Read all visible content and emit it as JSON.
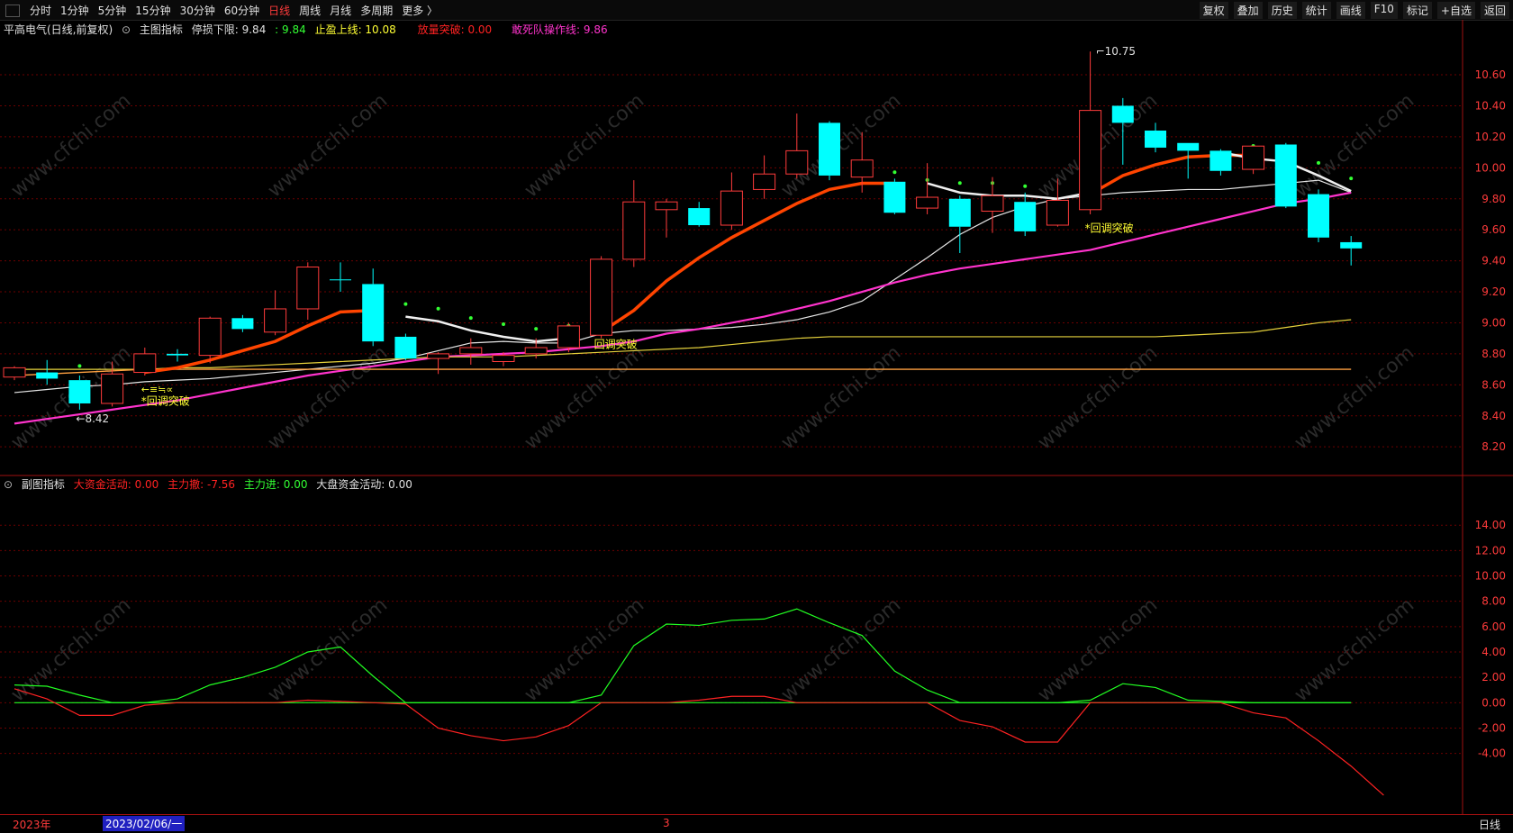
{
  "toolbar": {
    "periods": [
      "分时",
      "1分钟",
      "5分钟",
      "15分钟",
      "30分钟",
      "60分钟",
      "日线",
      "周线",
      "月线",
      "多周期",
      "更多 〉"
    ],
    "active_period": "日线",
    "right_buttons": [
      "复权",
      "叠加",
      "历史",
      "统计",
      "画线",
      "F10",
      "标记",
      "+自选",
      "返回"
    ]
  },
  "main_info": {
    "stock": "平高电气(日线,前复权)",
    "indicator": "主图指标",
    "stoploss_label": "停损下限: 9.84",
    "value2": ": 9.84",
    "takeprofit_label": "止盈上线: 10.08",
    "breakout_label": "放量突破: 0.00",
    "opline_label": "敢死队操作线: 9.86"
  },
  "sub_info": {
    "indicator": "副图指标",
    "big_active": "大资金活动: 0.00",
    "main_out": "主力撤: -7.56",
    "main_in": "主力进: 0.00",
    "market_active": "大盘资金活动: 0.00"
  },
  "annotations": {
    "high_label": "10.75",
    "low_label": "8.42",
    "signal1": "*回调突破",
    "signal2": "回调突破",
    "signal3": "*回调突破",
    "arrow_label": "←≡≒∝"
  },
  "watermark": "www.cfchi.com",
  "bottom": {
    "year": "2023年",
    "date_cursor": "2023/02/06/一",
    "month_mark": "3",
    "period_label": "日线"
  },
  "chart_data": [
    {
      "type": "candlestick",
      "title": "",
      "y_ticks": [
        8.2,
        8.4,
        8.6,
        8.8,
        9.0,
        9.2,
        9.4,
        9.6,
        9.8,
        10.0,
        10.2,
        10.4,
        10.6
      ],
      "ylim": [
        8.05,
        10.85
      ],
      "candles": [
        {
          "o": 8.65,
          "h": 8.72,
          "l": 8.63,
          "c": 8.71,
          "color": "red"
        },
        {
          "o": 8.68,
          "h": 8.76,
          "l": 8.6,
          "c": 8.64,
          "color": "cyan"
        },
        {
          "o": 8.63,
          "h": 8.66,
          "l": 8.44,
          "c": 8.48,
          "color": "cyan"
        },
        {
          "o": 8.48,
          "h": 8.75,
          "l": 8.46,
          "c": 8.67,
          "color": "red"
        },
        {
          "o": 8.68,
          "h": 8.84,
          "l": 8.66,
          "c": 8.8,
          "color": "red"
        },
        {
          "o": 8.79,
          "h": 8.83,
          "l": 8.75,
          "c": 8.8,
          "color": "cyan"
        },
        {
          "o": 8.79,
          "h": 9.04,
          "l": 8.74,
          "c": 9.03,
          "color": "red"
        },
        {
          "o": 9.03,
          "h": 9.05,
          "l": 8.94,
          "c": 8.96,
          "color": "cyan"
        },
        {
          "o": 8.94,
          "h": 9.21,
          "l": 8.92,
          "c": 9.09,
          "color": "red"
        },
        {
          "o": 9.09,
          "h": 9.39,
          "l": 9.02,
          "c": 9.36,
          "color": "red"
        },
        {
          "o": 9.28,
          "h": 9.39,
          "l": 9.2,
          "c": 9.28,
          "color": "cyan"
        },
        {
          "o": 9.25,
          "h": 9.35,
          "l": 8.85,
          "c": 8.88,
          "color": "cyan"
        },
        {
          "o": 8.91,
          "h": 8.93,
          "l": 8.76,
          "c": 8.77,
          "color": "cyan"
        },
        {
          "o": 8.77,
          "h": 8.81,
          "l": 8.67,
          "c": 8.8,
          "color": "red"
        },
        {
          "o": 8.8,
          "h": 8.9,
          "l": 8.73,
          "c": 8.84,
          "color": "red"
        },
        {
          "o": 8.75,
          "h": 8.81,
          "l": 8.72,
          "c": 8.79,
          "color": "red"
        },
        {
          "o": 8.8,
          "h": 8.9,
          "l": 8.77,
          "c": 8.84,
          "color": "red"
        },
        {
          "o": 8.84,
          "h": 9.0,
          "l": 8.81,
          "c": 8.98,
          "color": "red"
        },
        {
          "o": 8.92,
          "h": 9.43,
          "l": 8.9,
          "c": 9.41,
          "color": "red"
        },
        {
          "o": 9.41,
          "h": 9.92,
          "l": 9.36,
          "c": 9.78,
          "color": "red"
        },
        {
          "o": 9.73,
          "h": 9.8,
          "l": 9.55,
          "c": 9.78,
          "color": "red"
        },
        {
          "o": 9.74,
          "h": 9.78,
          "l": 9.62,
          "c": 9.63,
          "color": "cyan"
        },
        {
          "o": 9.63,
          "h": 9.97,
          "l": 9.6,
          "c": 9.85,
          "color": "red"
        },
        {
          "o": 9.86,
          "h": 10.08,
          "l": 9.8,
          "c": 9.96,
          "color": "red"
        },
        {
          "o": 9.96,
          "h": 10.35,
          "l": 9.93,
          "c": 10.11,
          "color": "red"
        },
        {
          "o": 10.29,
          "h": 10.3,
          "l": 9.92,
          "c": 9.95,
          "color": "cyan"
        },
        {
          "o": 9.94,
          "h": 10.23,
          "l": 9.84,
          "c": 10.05,
          "color": "red"
        },
        {
          "o": 9.91,
          "h": 9.93,
          "l": 9.7,
          "c": 9.71,
          "color": "cyan"
        },
        {
          "o": 9.74,
          "h": 10.03,
          "l": 9.7,
          "c": 9.81,
          "color": "red"
        },
        {
          "o": 9.8,
          "h": 9.82,
          "l": 9.45,
          "c": 9.62,
          "color": "cyan"
        },
        {
          "o": 9.72,
          "h": 9.94,
          "l": 9.58,
          "c": 9.82,
          "color": "red"
        },
        {
          "o": 9.78,
          "h": 9.84,
          "l": 9.56,
          "c": 9.59,
          "color": "cyan"
        },
        {
          "o": 9.63,
          "h": 9.93,
          "l": 9.62,
          "c": 9.79,
          "color": "red"
        },
        {
          "o": 9.73,
          "h": 10.75,
          "l": 9.7,
          "c": 10.37,
          "color": "red"
        },
        {
          "o": 10.4,
          "h": 10.45,
          "l": 10.02,
          "c": 10.29,
          "color": "cyan"
        },
        {
          "o": 10.24,
          "h": 10.29,
          "l": 10.1,
          "c": 10.13,
          "color": "cyan"
        },
        {
          "o": 10.16,
          "h": 10.16,
          "l": 9.93,
          "c": 10.11,
          "color": "cyan"
        },
        {
          "o": 10.11,
          "h": 10.12,
          "l": 9.95,
          "c": 9.98,
          "color": "cyan"
        },
        {
          "o": 9.99,
          "h": 10.14,
          "l": 9.96,
          "c": 10.14,
          "color": "red"
        },
        {
          "o": 10.15,
          "h": 10.16,
          "l": 9.74,
          "c": 9.75,
          "color": "cyan"
        },
        {
          "o": 9.83,
          "h": 9.86,
          "l": 9.52,
          "c": 9.55,
          "color": "cyan"
        },
        {
          "o": 9.52,
          "h": 9.56,
          "l": 9.37,
          "c": 9.48,
          "color": "cyan"
        }
      ],
      "series": [
        {
          "values": [
            8.55,
            8.57,
            8.59,
            8.6,
            8.62,
            8.63,
            8.64,
            8.66,
            8.68,
            8.7,
            8.72,
            8.74,
            8.77,
            8.82,
            8.87,
            8.88,
            8.87,
            8.87,
            8.93,
            8.95,
            8.95,
            8.96,
            8.97,
            8.99,
            9.02,
            9.07,
            9.14,
            9.28,
            9.42,
            9.57,
            9.68,
            9.75,
            9.8,
            9.82,
            9.84,
            9.85,
            9.86,
            9.86,
            9.88,
            9.9,
            9.92,
            9.84
          ]
        },
        {
          "values": [
            8.35,
            8.38,
            8.41,
            8.44,
            8.47,
            8.5,
            8.54,
            8.58,
            8.62,
            8.66,
            8.69,
            8.72,
            8.75,
            8.78,
            8.79,
            8.8,
            8.81,
            8.83,
            8.85,
            8.88,
            8.93,
            8.96,
            9.0,
            9.04,
            9.09,
            9.14,
            9.2,
            9.26,
            9.31,
            9.35,
            9.38,
            9.41,
            9.44,
            9.47,
            9.52,
            9.57,
            9.62,
            9.67,
            9.72,
            9.77,
            9.8,
            9.84
          ]
        },
        {
          "values": [
            8.7,
            8.7,
            8.7,
            8.7,
            8.7,
            8.71,
            8.71,
            8.72,
            8.73,
            8.74,
            8.75,
            8.76,
            8.77,
            8.78,
            8.78,
            8.78,
            8.79,
            8.8,
            8.81,
            8.82,
            8.83,
            8.84,
            8.86,
            8.88,
            8.9,
            8.91,
            8.91,
            8.91,
            8.91,
            8.91,
            8.91,
            8.91,
            8.91,
            8.91,
            8.91,
            8.91,
            8.92,
            8.93,
            8.94,
            8.97,
            9.0,
            9.02
          ]
        },
        {
          "values": [
            8.66,
            8.67,
            8.68,
            8.69,
            8.7,
            8.7,
            8.7,
            8.7,
            8.7,
            8.7,
            8.7,
            8.7,
            8.7,
            8.7,
            8.7,
            8.7,
            8.7,
            8.7,
            8.7,
            8.7,
            8.7,
            8.7,
            8.7,
            8.7,
            8.7,
            8.7,
            8.7,
            8.7,
            8.7,
            8.7,
            8.7,
            8.7,
            8.7,
            8.7,
            8.7,
            8.7,
            8.7,
            8.7,
            8.7,
            8.7,
            8.7,
            8.7
          ]
        },
        {
          "values": [
            null,
            null,
            null,
            null,
            8.68,
            8.71,
            8.76,
            8.82,
            8.88,
            8.98,
            9.07,
            9.08,
            null,
            null,
            null,
            null,
            null,
            null,
            8.94,
            9.08,
            9.27,
            9.42,
            9.55,
            9.66,
            9.77,
            9.86,
            9.9,
            9.9,
            null,
            null,
            null,
            null,
            null,
            9.83,
            9.95,
            10.02,
            10.07,
            10.08,
            10.08,
            null,
            null,
            null
          ]
        },
        {
          "values": [
            null,
            null,
            null,
            null,
            null,
            null,
            null,
            null,
            null,
            null,
            null,
            null,
            9.04,
            9.01,
            8.95,
            8.91,
            8.88,
            8.9,
            null,
            null,
            null,
            null,
            null,
            null,
            null,
            null,
            null,
            null,
            9.9,
            9.84,
            9.82,
            9.82,
            9.8,
            9.84,
            null,
            null,
            null,
            10.1,
            10.06,
            10.04,
            9.95,
            9.85
          ]
        },
        {
          "values": [
            null,
            null,
            8.64,
            null,
            8.68,
            null,
            null,
            null,
            null,
            null,
            null,
            null,
            9.04,
            9.01,
            8.95,
            8.91,
            8.88,
            8.9,
            null,
            null,
            null,
            null,
            null,
            null,
            null,
            null,
            null,
            9.89,
            9.84,
            9.82,
            9.82,
            9.8,
            null,
            null,
            null,
            null,
            null,
            null,
            10.06,
            10.04,
            9.95,
            9.85
          ]
        }
      ]
    },
    {
      "type": "line",
      "title": "",
      "y_ticks": [
        -4.0,
        -2.0,
        0.0,
        2.0,
        4.0,
        6.0,
        8.0,
        10.0,
        12.0,
        14.0
      ],
      "ylim": [
        -8.5,
        16.5
      ],
      "series": [
        {
          "values": [
            1.4,
            1.3,
            0.6,
            0.0,
            0.0,
            0.3,
            1.4,
            2.0,
            2.8,
            4.0,
            4.4,
            2.1,
            0.0,
            0.0,
            0.0,
            0.0,
            0.0,
            0.0,
            0.6,
            4.5,
            6.2,
            6.1,
            6.5,
            6.6,
            7.4,
            6.3,
            5.3,
            2.5,
            1.0,
            0.0,
            0.0,
            0.0,
            0.0,
            0.2,
            1.5,
            1.2,
            0.2,
            0.1,
            0.0,
            0.0,
            0.0,
            0.0
          ]
        },
        {
          "values": [
            1.1,
            0.3,
            -1.0,
            -1.0,
            -0.2,
            0.0,
            0.0,
            0.0,
            0.0,
            0.2,
            0.1,
            0.0,
            -0.1,
            -2.0,
            -2.6,
            -3.0,
            -2.7,
            -1.8,
            0.0,
            0.0,
            0.0,
            0.2,
            0.5,
            0.5,
            0.0,
            0.0,
            0.0,
            0.0,
            0.0,
            -1.4,
            -1.9,
            -3.1,
            -3.1,
            0.0,
            0.0,
            0.0,
            0.0,
            0.0,
            -0.8,
            -1.2,
            -3.0,
            -5.0,
            -7.3
          ]
        },
        {
          "values": [
            0.0,
            0.0,
            0.0,
            0.0,
            0.0,
            0.0,
            0.0,
            0.0,
            0.0,
            0.0,
            0.0,
            0.0,
            0.0,
            0.0,
            0.0,
            0.0,
            0.0,
            0.0,
            0.0,
            0.0,
            0.0,
            0.0,
            0.0,
            0.0,
            0.0,
            0.0,
            0.0,
            0.0,
            0.0,
            0.0,
            0.0,
            0.0,
            0.0,
            0.0,
            0.0,
            0.0,
            0.0,
            0.0,
            0.0,
            0.0,
            0.0,
            0.0
          ]
        }
      ]
    }
  ],
  "colors": {
    "up": "#ff3b3b",
    "down": "#00ffff",
    "ma_white": "#e6e6e6",
    "ma_magenta": "#ff33cc",
    "ma_yellow": "#e6d23c",
    "ma_flat": "#ffa040",
    "band_up": "#ff4400",
    "band_down": "#f0f0f0",
    "grid": "#6b0000",
    "sub_green": "#22ff22",
    "sub_red": "#ff2222"
  }
}
